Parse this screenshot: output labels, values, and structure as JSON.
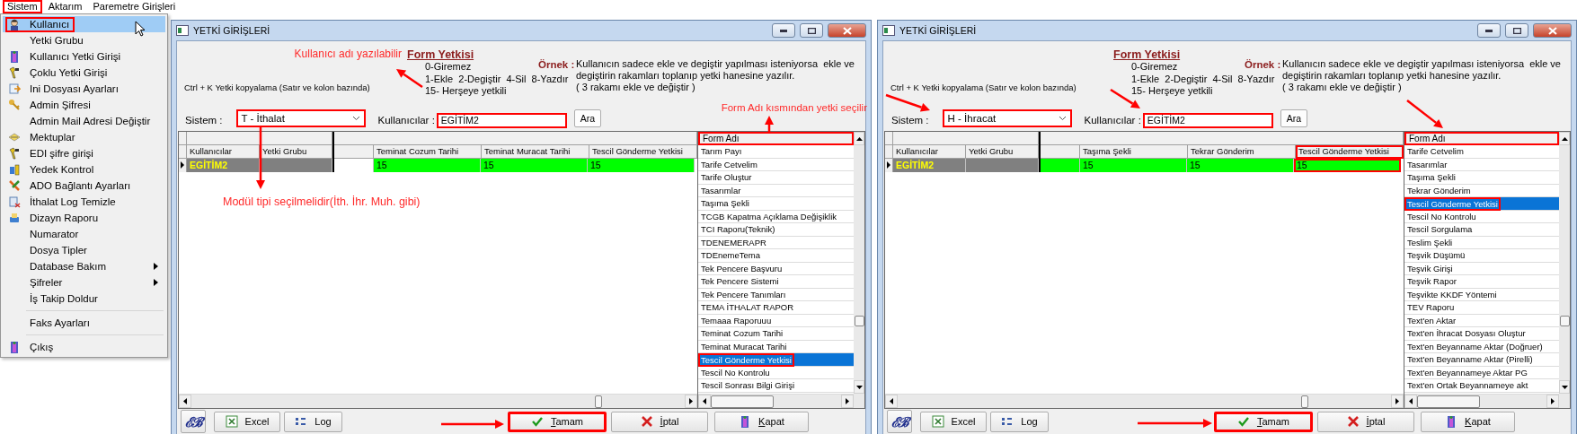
{
  "menubar": [
    {
      "label": "Sistem",
      "selected": true
    },
    {
      "label": "Aktarım",
      "selected": false
    },
    {
      "label": "Paremetre Girişleri",
      "selected": false
    }
  ],
  "menu": {
    "items": [
      {
        "kind": "command",
        "label": "Kullanıcı",
        "selected": true
      },
      {
        "kind": "command",
        "label": "Yetki Grubu",
        "selected": false
      },
      {
        "kind": "command",
        "label": "Kullanıcı Yetki Girişi",
        "selected": false
      },
      {
        "kind": "command",
        "label": "Çoklu Yetki Girişi",
        "selected": false
      },
      {
        "kind": "command",
        "label": "Ini Dosyası  Ayarları",
        "selected": false
      },
      {
        "kind": "command",
        "label": "Admin Şifresi",
        "selected": false
      },
      {
        "kind": "command",
        "label": "Admin Mail Adresi Değiştir",
        "selected": false
      },
      {
        "kind": "command",
        "label": "Mektuplar",
        "selected": false
      },
      {
        "kind": "command",
        "label": "EDI şifre girişi",
        "selected": false
      },
      {
        "kind": "command",
        "label": "Yedek Kontrol",
        "selected": false
      },
      {
        "kind": "command",
        "label": "ADO Bağlantı Ayarları",
        "selected": false
      },
      {
        "kind": "command",
        "label": "İthalat Log Temizle",
        "selected": false
      },
      {
        "kind": "command",
        "label": "Dizayn Raporu",
        "selected": false
      },
      {
        "kind": "command",
        "label": "Numarator",
        "selected": false
      },
      {
        "kind": "command",
        "label": "Dosya Tipler",
        "selected": false
      },
      {
        "kind": "submenu",
        "label": "Database Bakım",
        "selected": false
      },
      {
        "kind": "submenu",
        "label": "Şifreler",
        "selected": false
      },
      {
        "kind": "command",
        "label": "İş Takip Doldur",
        "selected": false
      },
      {
        "kind": "separator"
      },
      {
        "kind": "command",
        "label": "Faks Ayarları",
        "selected": false
      },
      {
        "kind": "separator"
      },
      {
        "kind": "command",
        "label": "Çıkış",
        "selected": false
      }
    ]
  },
  "windows": [
    {
      "title": "YETKİ GİRİŞLERİ",
      "copy_hint": "Ctrl + K Yetki kopyalama (Satır ve kolon bazında)",
      "legend": {
        "title": "Form Yetkisi",
        "lines": [
          "0-Giremez",
          "1-Ekle  2-Degiştir  4-Sil  8-Yazdır",
          "15- Herşeye yetkili"
        ]
      },
      "example": {
        "label": "Örnek :",
        "lines": [
          "Kullanıcın sadece ekle ve degiştir yapılması isteniyorsa  ekle ve",
          "degiştirin rakamları toplanıp yetki hanesine yazılır.",
          "( 3 rakamı ekle ve değiştir )"
        ]
      },
      "system": {
        "label": "Sistem :",
        "value": "T - İthalat",
        "highlighted": true
      },
      "users": {
        "label": "Kullanıcılar :",
        "value": "EGİTİM2",
        "highlighted": true
      },
      "search_button": "Ara",
      "grid": {
        "fixed_columns": [
          "Kullanıcılar",
          "Yetki Grubu"
        ],
        "columns": [
          {
            "label": "Teminat Cozum Tarihi",
            "highlighted": false
          },
          {
            "label": "Teminat Muracat Tarihi",
            "highlighted": false
          },
          {
            "label": "Tescil Gönderme Yetkisi",
            "highlighted": false
          }
        ],
        "rows": [
          {
            "user": "EGİTİM2",
            "spacer_filled": false,
            "values": [
              "15",
              "15",
              "15"
            ]
          }
        ]
      },
      "form_list": {
        "header": "Form Adı",
        "highlighted": true,
        "items": [
          {
            "label": "Tarım Payı",
            "selected": false
          },
          {
            "label": "Tarife Cetvelim",
            "selected": false
          },
          {
            "label": "Tarife Oluştur",
            "selected": false
          },
          {
            "label": "Tasarımlar",
            "selected": false
          },
          {
            "label": "Taşıma Şekli",
            "selected": false
          },
          {
            "label": "TCGB Kapatma Açıklama Değişiklik",
            "selected": false
          },
          {
            "label": "TCI Raporu(Teknik)",
            "selected": false
          },
          {
            "label": "TDENEMERAPR",
            "selected": false
          },
          {
            "label": "TDEnemeTema",
            "selected": false
          },
          {
            "label": "Tek Pencere Başvuru",
            "selected": false
          },
          {
            "label": "Tek Pencere Sistemi",
            "selected": false
          },
          {
            "label": "Tek Pencere Tanımları",
            "selected": false
          },
          {
            "label": "TEMA İTHALAT RAPOR",
            "selected": false
          },
          {
            "label": "Temaaa Raporuuu",
            "selected": false
          },
          {
            "label": "Teminat Cozum Tarihi",
            "selected": false
          },
          {
            "label": "Teminat Muracat Tarihi",
            "selected": false
          },
          {
            "label": "Tescil Gönderme Yetkisi",
            "selected": true
          },
          {
            "label": "Tescil No Kontrolu",
            "selected": false
          },
          {
            "label": "Tescil Sonrası Bilgi Girişi",
            "selected": false
          }
        ]
      },
      "buttons": [
        {
          "kind": "logo",
          "label": "ℰℬ",
          "highlighted": false
        },
        {
          "kind": "excel",
          "label": "Excel",
          "highlighted": false
        },
        {
          "kind": "log",
          "label": "Log",
          "highlighted": false
        },
        {
          "kind": "ok",
          "label": "Tamam",
          "highlighted": true
        },
        {
          "kind": "cancel",
          "label": "İptal",
          "highlighted": false
        },
        {
          "kind": "close",
          "label": "Kapat",
          "highlighted": false
        }
      ],
      "notes": [
        {
          "kind": "user-name",
          "text": "Kullanıcı adı yazılabilir"
        },
        {
          "kind": "module",
          "text": "Modül tipi seçilmelidir(İth. İhr. Muh. gibi)"
        },
        {
          "kind": "form-name",
          "text": "Form Adı kısmından yetki seçilir"
        }
      ]
    },
    {
      "title": "YETKİ GİRİŞLERİ",
      "copy_hint": "Ctrl + K Yetki kopyalama (Satır ve kolon bazında)",
      "legend": {
        "title": "Form Yetkisi",
        "lines": [
          "0-Giremez",
          "1-Ekle  2-Degiştir  4-Sil  8-Yazdır",
          "15- Herşeye yetkili"
        ]
      },
      "example": {
        "label": "Örnek :",
        "lines": [
          "Kullanıcın sadece ekle ve degiştir yapılması isteniyorsa  ekle ve",
          "degiştirin rakamları toplanıp yetki hanesine yazılır.",
          "( 3 rakamı ekle ve değiştir )"
        ]
      },
      "system": {
        "label": "Sistem :",
        "value": "H - İhracat",
        "highlighted": true
      },
      "users": {
        "label": "Kullanıcılar :",
        "value": "EGİTİM2",
        "highlighted": true
      },
      "search_button": "Ara",
      "grid": {
        "fixed_columns": [
          "Kullanıcılar",
          "Yetki Grubu"
        ],
        "columns": [
          {
            "label": "Taşıma Şekli",
            "highlighted": false
          },
          {
            "label": "Tekrar Gönderim",
            "highlighted": false
          },
          {
            "label": "Tescil Gönderme Yetkisi",
            "highlighted": true
          }
        ],
        "rows": [
          {
            "user": "EGİTİM2",
            "spacer_filled": true,
            "values": [
              "15",
              "15",
              "15"
            ]
          }
        ]
      },
      "form_list": {
        "header": "Form Adı",
        "highlighted": true,
        "items": [
          {
            "label": "Tarife Cetvelim",
            "selected": false
          },
          {
            "label": "Tasarımlar",
            "selected": false
          },
          {
            "label": "Taşıma Şekli",
            "selected": false
          },
          {
            "label": "Tekrar Gönderim",
            "selected": false
          },
          {
            "label": "Tescil Gönderme Yetkisi",
            "selected": true
          },
          {
            "label": "Tescil No Kontrolu",
            "selected": false
          },
          {
            "label": "Tescil Sorgulama",
            "selected": false
          },
          {
            "label": "Teslim Şekli",
            "selected": false
          },
          {
            "label": "Teşvik Düşümü",
            "selected": false
          },
          {
            "label": "Teşvik Girişi",
            "selected": false
          },
          {
            "label": "Teşvik Rapor",
            "selected": false
          },
          {
            "label": "Teşvikte KKDF Yöntemi",
            "selected": false
          },
          {
            "label": "TEV Raporu",
            "selected": false
          },
          {
            "label": "Text'en Aktar",
            "selected": false
          },
          {
            "label": "Text'en İhracat Dosyası Oluştur",
            "selected": false
          },
          {
            "label": "Text'en Beyanname Aktar (Doğruer)",
            "selected": false
          },
          {
            "label": "Text'en Beyanname Aktar (Pirelli)",
            "selected": false
          },
          {
            "label": "Text'en Beyannameye Aktar PG",
            "selected": false
          },
          {
            "label": "Text'en Ortak Beyannameye akt",
            "selected": false
          }
        ]
      },
      "buttons": [
        {
          "kind": "logo",
          "label": "ℰℬ",
          "highlighted": false
        },
        {
          "kind": "excel",
          "label": "Excel",
          "highlighted": false
        },
        {
          "kind": "log",
          "label": "Log",
          "highlighted": false
        },
        {
          "kind": "ok",
          "label": "Tamam",
          "highlighted": true
        },
        {
          "kind": "cancel",
          "label": "İptal",
          "highlighted": false
        },
        {
          "kind": "close",
          "label": "Kapat",
          "highlighted": false
        }
      ]
    }
  ]
}
